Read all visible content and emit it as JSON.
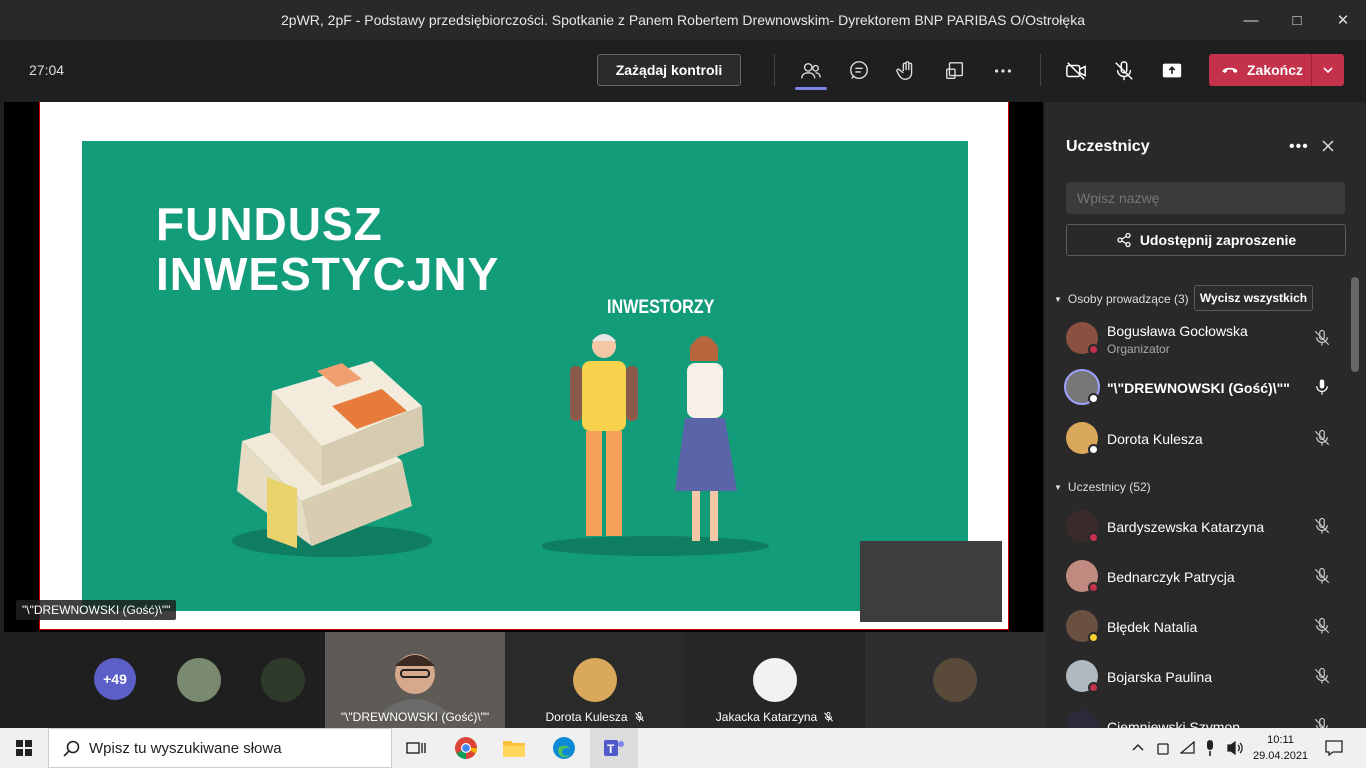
{
  "window": {
    "title": "2pWR, 2pF - Podstawy przedsiębiorczości. Spotkanie z Panem Robertem Drewnowskim- Dyrektorem BNP PARIBAS O/Ostrołęka"
  },
  "toolbar": {
    "timer": "27:04",
    "request_control": "Zażądaj kontroli",
    "end_call": "Zakończ"
  },
  "slide": {
    "title_line1": "FUNDUSZ",
    "title_line2": "INWESTYCJNY",
    "subtitle": "INWESTORZY"
  },
  "stage": {
    "presenter_label": "\"\\\"DREWNOWSKI (Gość)\\\"\""
  },
  "gallery": {
    "overflow_count": "+49",
    "tiles": [
      {
        "name": "\"\\\"DREWNOWSKI (Gość)\\\"\""
      },
      {
        "name": "Dorota Kulesza"
      },
      {
        "name": "Jakacka Katarzyna"
      }
    ]
  },
  "panel": {
    "title": "Uczestnicy",
    "search_placeholder": "Wpisz nazwę",
    "invite": "Udostępnij zaproszenie",
    "presenters_section": "Osoby prowadzące (3)",
    "mute_all": "Wycisz wszystkich",
    "attendees_section": "Uczestnicy (52)",
    "presenters": [
      {
        "name": "Bogusława Gocłowska",
        "role": "Organizator"
      },
      {
        "name": "\"\\\"DREWNOWSKI (Gość)\\\"\"",
        "role": ""
      },
      {
        "name": "Dorota Kulesza",
        "role": ""
      }
    ],
    "attendees": [
      {
        "name": "Bardyszewska Katarzyna"
      },
      {
        "name": "Bednarczyk Patrycja"
      },
      {
        "name": "Błędek Natalia"
      },
      {
        "name": "Bojarska Paulina"
      },
      {
        "name": "Ciemniewski Szymon"
      }
    ]
  },
  "taskbar": {
    "search_placeholder": "Wpisz tu wyszukiwane słowa",
    "time": "10:11",
    "date": "29.04.2021"
  },
  "colors": {
    "accent": "#7b83eb",
    "end_call": "#c4314b",
    "slide_green": "#139c7a",
    "status_busy": "#c4314b"
  }
}
